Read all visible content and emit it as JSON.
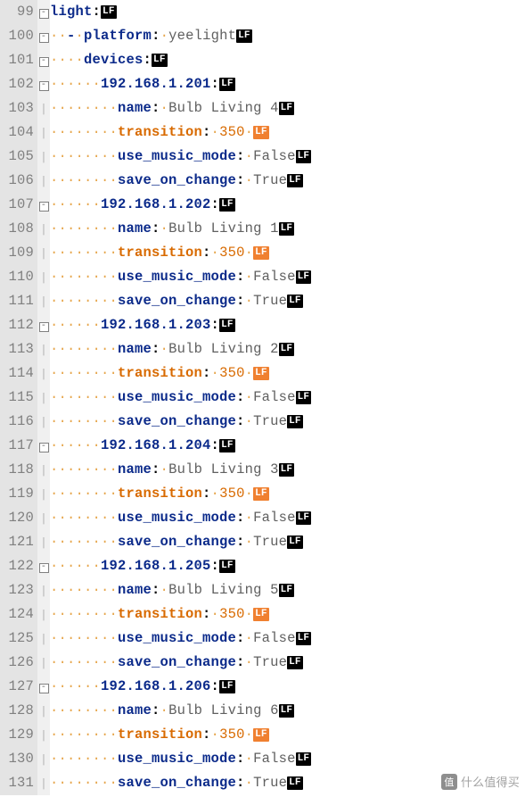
{
  "lf_label": "LF",
  "watermark": {
    "icon": "值",
    "text": "什么值得买"
  },
  "lines": [
    {
      "n": 99,
      "fold": "box",
      "ws": "",
      "dash": false,
      "key": "light",
      "val": null,
      "hl": false
    },
    {
      "n": 100,
      "fold": "box",
      "ws": "··",
      "dash": true,
      "key": "platform",
      "val": "yeelight",
      "hl": false
    },
    {
      "n": 101,
      "fold": "box",
      "ws": "····",
      "dash": false,
      "key": "devices",
      "val": null,
      "hl": false
    },
    {
      "n": 102,
      "fold": "box",
      "ws": "······",
      "dash": false,
      "key": "192.168.1.201",
      "val": null,
      "hl": false
    },
    {
      "n": 103,
      "fold": "line",
      "ws": "········",
      "dash": false,
      "key": "name",
      "val": "Bulb Living 4",
      "hl": false
    },
    {
      "n": 104,
      "fold": "line",
      "ws": "········",
      "dash": false,
      "key": "transition",
      "val": "350",
      "hl": true
    },
    {
      "n": 105,
      "fold": "line",
      "ws": "········",
      "dash": false,
      "key": "use_music_mode",
      "val": "False",
      "hl": false
    },
    {
      "n": 106,
      "fold": "line",
      "ws": "········",
      "dash": false,
      "key": "save_on_change",
      "val": "True",
      "hl": false
    },
    {
      "n": 107,
      "fold": "box",
      "ws": "······",
      "dash": false,
      "key": "192.168.1.202",
      "val": null,
      "hl": false
    },
    {
      "n": 108,
      "fold": "line",
      "ws": "········",
      "dash": false,
      "key": "name",
      "val": "Bulb Living 1",
      "hl": false
    },
    {
      "n": 109,
      "fold": "line",
      "ws": "········",
      "dash": false,
      "key": "transition",
      "val": "350",
      "hl": true
    },
    {
      "n": 110,
      "fold": "line",
      "ws": "········",
      "dash": false,
      "key": "use_music_mode",
      "val": "False",
      "hl": false
    },
    {
      "n": 111,
      "fold": "line",
      "ws": "········",
      "dash": false,
      "key": "save_on_change",
      "val": "True",
      "hl": false
    },
    {
      "n": 112,
      "fold": "box",
      "ws": "······",
      "dash": false,
      "key": "192.168.1.203",
      "val": null,
      "hl": false
    },
    {
      "n": 113,
      "fold": "line",
      "ws": "········",
      "dash": false,
      "key": "name",
      "val": "Bulb Living 2",
      "hl": false
    },
    {
      "n": 114,
      "fold": "line",
      "ws": "········",
      "dash": false,
      "key": "transition",
      "val": "350",
      "hl": true
    },
    {
      "n": 115,
      "fold": "line",
      "ws": "········",
      "dash": false,
      "key": "use_music_mode",
      "val": "False",
      "hl": false
    },
    {
      "n": 116,
      "fold": "line",
      "ws": "········",
      "dash": false,
      "key": "save_on_change",
      "val": "True",
      "hl": false
    },
    {
      "n": 117,
      "fold": "box",
      "ws": "······",
      "dash": false,
      "key": "192.168.1.204",
      "val": null,
      "hl": false
    },
    {
      "n": 118,
      "fold": "line",
      "ws": "········",
      "dash": false,
      "key": "name",
      "val": "Bulb Living 3",
      "hl": false
    },
    {
      "n": 119,
      "fold": "line",
      "ws": "········",
      "dash": false,
      "key": "transition",
      "val": "350",
      "hl": true
    },
    {
      "n": 120,
      "fold": "line",
      "ws": "········",
      "dash": false,
      "key": "use_music_mode",
      "val": "False",
      "hl": false
    },
    {
      "n": 121,
      "fold": "line",
      "ws": "········",
      "dash": false,
      "key": "save_on_change",
      "val": "True",
      "hl": false
    },
    {
      "n": 122,
      "fold": "box",
      "ws": "······",
      "dash": false,
      "key": "192.168.1.205",
      "val": null,
      "hl": false
    },
    {
      "n": 123,
      "fold": "line",
      "ws": "········",
      "dash": false,
      "key": "name",
      "val": "Bulb Living 5",
      "hl": false
    },
    {
      "n": 124,
      "fold": "line",
      "ws": "········",
      "dash": false,
      "key": "transition",
      "val": "350",
      "hl": true
    },
    {
      "n": 125,
      "fold": "line",
      "ws": "········",
      "dash": false,
      "key": "use_music_mode",
      "val": "False",
      "hl": false
    },
    {
      "n": 126,
      "fold": "line",
      "ws": "········",
      "dash": false,
      "key": "save_on_change",
      "val": "True",
      "hl": false
    },
    {
      "n": 127,
      "fold": "box",
      "ws": "······",
      "dash": false,
      "key": "192.168.1.206",
      "val": null,
      "hl": false
    },
    {
      "n": 128,
      "fold": "line",
      "ws": "········",
      "dash": false,
      "key": "name",
      "val": "Bulb Living 6",
      "hl": false
    },
    {
      "n": 129,
      "fold": "line",
      "ws": "········",
      "dash": false,
      "key": "transition",
      "val": "350",
      "hl": true
    },
    {
      "n": 130,
      "fold": "line",
      "ws": "········",
      "dash": false,
      "key": "use_music_mode",
      "val": "False",
      "hl": false
    },
    {
      "n": 131,
      "fold": "line",
      "ws": "········",
      "dash": false,
      "key": "save_on_change",
      "val": "True",
      "hl": false
    }
  ]
}
